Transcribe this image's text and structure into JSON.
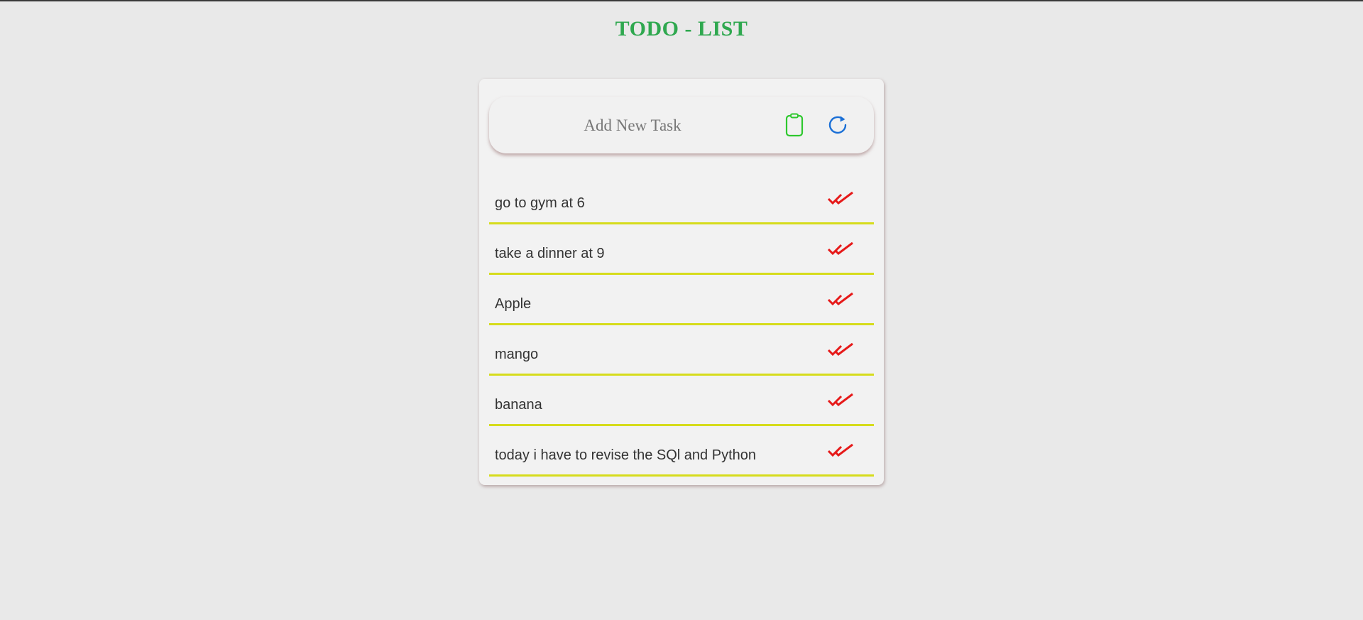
{
  "header": {
    "title": "TODO - LIST"
  },
  "input_bar": {
    "placeholder": "Add New Task",
    "value": "",
    "add_icon": "clipboard-icon",
    "refresh_icon": "refresh-icon"
  },
  "tasks": [
    {
      "text": "go to gym at 6",
      "icon": "double-check-icon"
    },
    {
      "text": "take a dinner at 9",
      "icon": "double-check-icon"
    },
    {
      "text": "Apple",
      "icon": "double-check-icon"
    },
    {
      "text": "mango",
      "icon": "double-check-icon"
    },
    {
      "text": "banana",
      "icon": "double-check-icon"
    },
    {
      "text": "today i have to revise the SQl and Python",
      "icon": "double-check-icon"
    }
  ],
  "colors": {
    "title": "#2fa84f",
    "clipboard_icon": "#2ec82e",
    "refresh_icon": "#1a6fd6",
    "check_icon": "#e61a1a",
    "task_underline": "#d6dc1c"
  }
}
